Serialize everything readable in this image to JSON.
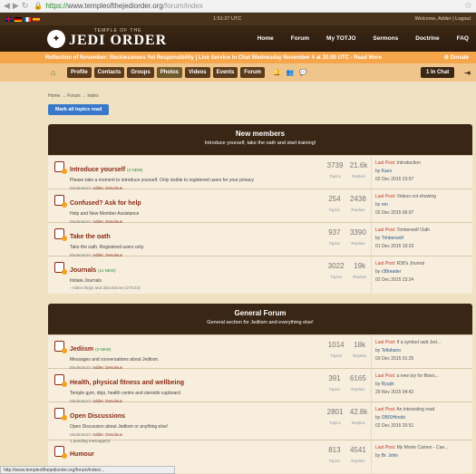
{
  "browser": {
    "scheme": "https://",
    "domain": "www.templeofthejediorder.org",
    "path": "/forum/index"
  },
  "topstrip": {
    "time": "1:51:27 UTC",
    "welcome": "Welcome, Adder | Logout"
  },
  "logo": {
    "small": "TEMPLE OF THE",
    "big": "JEDI ORDER"
  },
  "mainnav": [
    "Home",
    "Forum",
    "My TOTJO",
    "Sermons",
    "Doctrine",
    "FAQ"
  ],
  "announce": {
    "text": "Reflection of November: Recklessness Yet Responsibility | Live Service in Chat Wednesday November 4 at 20:00 UTC - Read More",
    "donate": "Donate"
  },
  "subnav": {
    "items": [
      "Profile",
      "Contacts",
      "Groups",
      "Photos",
      "Videos",
      "Events",
      "Forum"
    ],
    "inchat": "1 In Chat"
  },
  "breadcrumb": "Home → Forum → Index",
  "mark_button": "Mark all topics read",
  "categories": [
    {
      "title": "New members",
      "desc": "Introduce yourself, take the oath and start training!",
      "forums": [
        {
          "title": "Introduce yourself",
          "newtag": "(4 NEW)",
          "desc": "Please take a moment to introduce yourself. Only visible to registered users for your privacy.",
          "mods": "Adder, Desolous",
          "topics": "3739",
          "replies": "21.6k",
          "lp_title": "Introduction",
          "lp_by": "Kaos",
          "lp_date": "02 Dec 2015 23:57",
          "sub": "",
          "pending": ""
        },
        {
          "title": "Confused? Ask for help",
          "newtag": "",
          "desc": "Help and New Member Assistance",
          "mods": "Adder, Desolous",
          "topics": "254",
          "replies": "2438",
          "lp_title": "Videos not showing",
          "lp_by": "ren",
          "lp_date": "02 Dec 2015 06:07",
          "sub": "",
          "pending": ""
        },
        {
          "title": "Take the oath",
          "newtag": "",
          "desc": "Take the oath. Registered users only.",
          "mods": "Adder, Desolous",
          "topics": "937",
          "replies": "3390",
          "lp_title": "Timberwolf Oath",
          "lp_by": "Timberwolf",
          "lp_date": "01 Dec 2015 19:23",
          "sub": "",
          "pending": ""
        },
        {
          "title": "Journals",
          "newtag": "(11 NEW)",
          "desc": "Initiate Journals",
          "mods": "Adder, Desolous",
          "topics": "3022",
          "replies": "19k",
          "lp_title": "R38's Journal",
          "lp_by": "r38reader",
          "lp_date": "02 Dec 2015 23:24",
          "sub": "Video blogs and discussions (27/144)",
          "pending": ""
        }
      ]
    },
    {
      "title": "General Forum",
      "desc": "General section for Jediism and everything else!",
      "forums": [
        {
          "title": "Jediism",
          "newtag": "(2 NEW)",
          "desc": "Messages and conversations about Jediism.",
          "mods": "Adder, Desolous",
          "topics": "1014",
          "replies": "18k",
          "lp_title": "If a symbol said Jed...",
          "lp_by": "Tellahano",
          "lp_date": "03 Dec 2015 01:25",
          "sub": "",
          "pending": ""
        },
        {
          "title": "Health, physical fitness and wellbeing",
          "newtag": "",
          "desc": "Temple gym, dojo, health centre and steroids cupboard.",
          "mods": "Adder, Desolous",
          "topics": "391",
          "replies": "6165",
          "lp_title": "a new toy for fitnes...",
          "lp_by": "Ryujin",
          "lp_date": "29 Nov 2015 04:42",
          "sub": "",
          "pending": ""
        },
        {
          "title": "Open Discussions",
          "newtag": "",
          "desc": "Open Discussion about Jediism or anything else!",
          "mods": "Adder, Desolous",
          "topics": "2801",
          "replies": "42.8k",
          "lp_title": "An interesting read",
          "lp_by": "OBISHinobi",
          "lp_date": "02 Dec 2015 20:51",
          "sub": "",
          "pending": "1 pending message(s)"
        },
        {
          "title": "Humour",
          "newtag": "",
          "desc": "",
          "mods": "",
          "topics": "813",
          "replies": "4541",
          "lp_title": "My Movie Cameo - Cae...",
          "lp_by": "Br. John",
          "lp_date": "",
          "sub": "",
          "pending": ""
        }
      ]
    }
  ],
  "labels": {
    "topics": "Topics",
    "replies": "Replies",
    "last_post": "Last Post:",
    "by": "by",
    "moderators": "Moderators:"
  },
  "status_bar": "http://www.templeofthejediorder.org/forum/index/..."
}
